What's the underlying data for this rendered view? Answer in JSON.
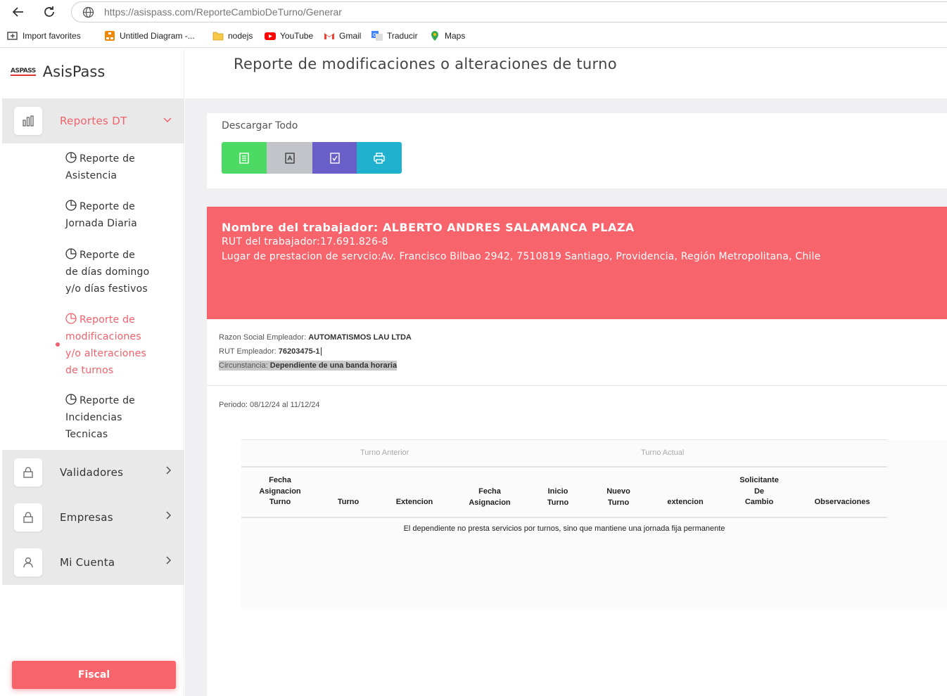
{
  "browser": {
    "url_host": "https://asispass.com",
    "url_path": "/ReporteCambioDeTurno/Generar",
    "bookmarks": [
      "Import favorites",
      "Untitled Diagram -...",
      "nodejs",
      "YouTube",
      "Gmail",
      "Traducir",
      "Maps"
    ]
  },
  "sidebar": {
    "brand_mark": "ASPASS",
    "brand": "AsisPass",
    "reportes": {
      "label": "Reportes DT",
      "items": [
        {
          "lines": [
            "Reporte de",
            "Asistencia"
          ]
        },
        {
          "lines": [
            "Reporte de",
            "Jornada Diaria"
          ]
        },
        {
          "lines": [
            "Reporte de",
            "de días domingo",
            "y/o días festivos"
          ]
        },
        {
          "lines": [
            "Reporte de",
            "modificaciones",
            "y/o alteraciones",
            "de turnos"
          ]
        },
        {
          "lines": [
            "Reporte de",
            "Incidencias",
            "Tecnicas"
          ]
        }
      ]
    },
    "validadores": "Validadores",
    "empresas": "Empresas",
    "mi_cuenta": "Mi Cuenta",
    "fiscal": "Fiscal"
  },
  "main": {
    "title": "Reporte de modificaciones o alteraciones de turno",
    "download_label": "Descargar Todo",
    "colors": {
      "excel": "#4cd964",
      "pdf": "#c3c4c9",
      "word": "#6a5fc8",
      "print": "#20b1cf",
      "accent": "#f7646c"
    },
    "worker": {
      "name": "Nombre del trabajador: ALBERTO ANDRES SALAMANCA PLAZA",
      "rut": "RUT del trabajador:17.691.826-8",
      "place": "Lugar de prestacion de servcio:Av. Francisco Bilbao 2942, 7510819 Santiago, Providencia, Región Metropolitana, Chile"
    },
    "employer": {
      "razon_label": "Razon Social Empleador: ",
      "razon_value": "AUTOMATISMOS LAU LTDA",
      "rut_label": "RUT Empleador: ",
      "rut_value": "76203475-1",
      "circ_label": "Circunstancia: ",
      "circ_value": "Dependiente de una banda horaria"
    },
    "periodo": "Periodo: 08/12/24 al 11/12/24",
    "table": {
      "group_prev": "Turno Anterior",
      "group_curr": "Turno Actual",
      "headers": [
        [
          "Fecha",
          "Asignacion",
          "Turno"
        ],
        [
          "Turno"
        ],
        [
          "Extencion"
        ],
        [
          "Fecha",
          "Asignacion"
        ],
        [
          "Inicio",
          "Turno"
        ],
        [
          "Nuevo",
          "Turno"
        ],
        [
          "extencion"
        ],
        [
          "Solicitante",
          "De",
          "Cambio"
        ],
        [
          "Observaciones"
        ]
      ],
      "empty_message": "El dependiente no presta servicios por turnos, sino que mantiene una jornada fija permanente"
    }
  }
}
